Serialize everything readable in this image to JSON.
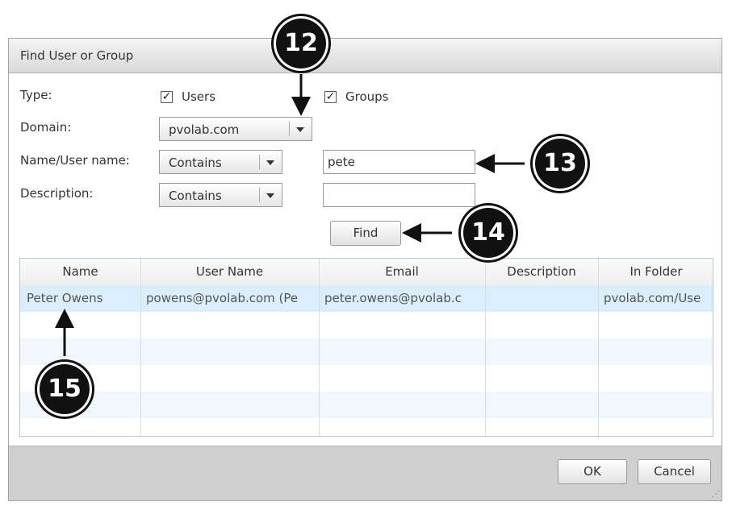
{
  "dialog": {
    "title": "Find User or Group",
    "type_label": "Type:",
    "users_label": "Users",
    "users_checked": "✓",
    "groups_label": "Groups",
    "groups_checked": "✓",
    "domain_label": "Domain:",
    "domain_value": "pvolab.com",
    "name_label": "Name/User name:",
    "name_match": "Contains",
    "name_value": "pete",
    "desc_label": "Description:",
    "desc_match": "Contains",
    "desc_value": "",
    "find_label": "Find",
    "ok_label": "OK",
    "cancel_label": "Cancel"
  },
  "grid": {
    "columns": [
      "Name",
      "User Name",
      "Email",
      "Description",
      "In Folder"
    ],
    "rows": [
      [
        "Peter Owens",
        "powens@pvolab.com (Pe",
        "peter.owens@pvolab.c",
        "",
        "pvolab.com/Use"
      ]
    ]
  },
  "callouts": [
    "12",
    "13",
    "14",
    "15"
  ]
}
